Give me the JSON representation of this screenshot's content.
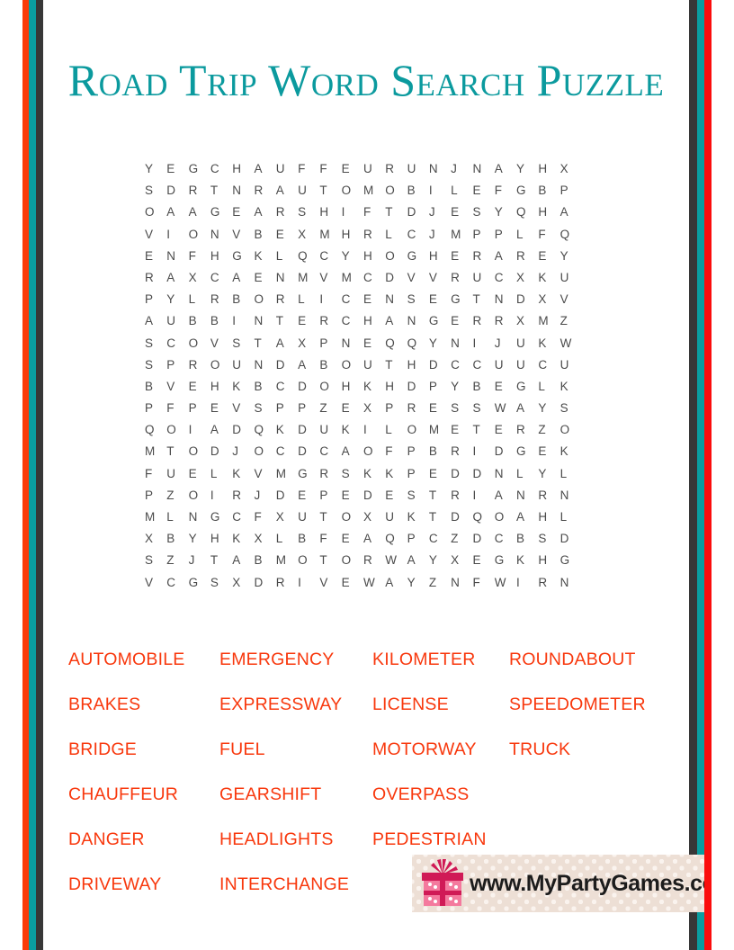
{
  "page": {
    "title": "Road Trip Word Search Puzzle",
    "colors": {
      "title_teal": "#0B9A9E",
      "word_red": "#F8380D",
      "grid_gray": "#4B4B4B",
      "border_red": "#FA3C0A",
      "border_teal": "#0A9DA0",
      "border_dark": "#373737",
      "watermark_bg": "#EDDFD5",
      "gift_pink": "#F47A9E",
      "gift_magenta": "#D01A56"
    }
  },
  "grid": {
    "rows": 20,
    "cols": 20,
    "letters": [
      [
        "Y",
        "E",
        "G",
        "C",
        "H",
        "A",
        "U",
        "F",
        "F",
        "E",
        "U",
        "R",
        "U",
        "N",
        "J",
        "N",
        "A",
        "Y",
        "H",
        "X"
      ],
      [
        "S",
        "D",
        "R",
        "T",
        "N",
        "R",
        "A",
        "U",
        "T",
        "O",
        "M",
        "O",
        "B",
        "I",
        "L",
        "E",
        "F",
        "G",
        "B",
        "P"
      ],
      [
        "O",
        "A",
        "A",
        "G",
        "E",
        "A",
        "R",
        "S",
        "H",
        "I",
        "F",
        "T",
        "D",
        "J",
        "E",
        "S",
        "Y",
        "Q",
        "H",
        "A"
      ],
      [
        "V",
        "I",
        "O",
        "N",
        "V",
        "B",
        "E",
        "X",
        "M",
        "H",
        "R",
        "L",
        "C",
        "J",
        "M",
        "P",
        "P",
        "L",
        "F",
        "Q"
      ],
      [
        "E",
        "N",
        "F",
        "H",
        "G",
        "K",
        "L",
        "Q",
        "C",
        "Y",
        "H",
        "O",
        "G",
        "H",
        "E",
        "R",
        "A",
        "R",
        "E",
        "Y"
      ],
      [
        "R",
        "A",
        "X",
        "C",
        "A",
        "E",
        "N",
        "M",
        "V",
        "M",
        "C",
        "D",
        "V",
        "V",
        "R",
        "U",
        "C",
        "X",
        "K",
        "U"
      ],
      [
        "P",
        "Y",
        "L",
        "R",
        "B",
        "O",
        "R",
        "L",
        "I",
        "C",
        "E",
        "N",
        "S",
        "E",
        "G",
        "T",
        "N",
        "D",
        "X",
        "V"
      ],
      [
        "A",
        "U",
        "B",
        "B",
        "I",
        "N",
        "T",
        "E",
        "R",
        "C",
        "H",
        "A",
        "N",
        "G",
        "E",
        "R",
        "R",
        "X",
        "M",
        "Z"
      ],
      [
        "S",
        "C",
        "O",
        "V",
        "S",
        "T",
        "A",
        "X",
        "P",
        "N",
        "E",
        "Q",
        "Q",
        "Y",
        "N",
        "I",
        "J",
        "U",
        "K",
        "W"
      ],
      [
        "S",
        "P",
        "R",
        "O",
        "U",
        "N",
        "D",
        "A",
        "B",
        "O",
        "U",
        "T",
        "H",
        "D",
        "C",
        "C",
        "U",
        "U",
        "C",
        "U"
      ],
      [
        "B",
        "V",
        "E",
        "H",
        "K",
        "B",
        "C",
        "D",
        "O",
        "H",
        "K",
        "H",
        "D",
        "P",
        "Y",
        "B",
        "E",
        "G",
        "L",
        "K"
      ],
      [
        "P",
        "F",
        "P",
        "E",
        "V",
        "S",
        "P",
        "P",
        "Z",
        "E",
        "X",
        "P",
        "R",
        "E",
        "S",
        "S",
        "W",
        "A",
        "Y",
        "S"
      ],
      [
        "Q",
        "O",
        "I",
        "A",
        "D",
        "Q",
        "K",
        "D",
        "U",
        "K",
        "I",
        "L",
        "O",
        "M",
        "E",
        "T",
        "E",
        "R",
        "Z",
        "O"
      ],
      [
        "M",
        "T",
        "O",
        "D",
        "J",
        "O",
        "C",
        "D",
        "C",
        "A",
        "O",
        "F",
        "P",
        "B",
        "R",
        "I",
        "D",
        "G",
        "E",
        "K"
      ],
      [
        "F",
        "U",
        "E",
        "L",
        "K",
        "V",
        "M",
        "G",
        "R",
        "S",
        "K",
        "K",
        "P",
        "E",
        "D",
        "D",
        "N",
        "L",
        "Y",
        "L"
      ],
      [
        "P",
        "Z",
        "O",
        "I",
        "R",
        "J",
        "D",
        "E",
        "P",
        "E",
        "D",
        "E",
        "S",
        "T",
        "R",
        "I",
        "A",
        "N",
        "R",
        "N"
      ],
      [
        "M",
        "L",
        "N",
        "G",
        "C",
        "F",
        "X",
        "U",
        "T",
        "O",
        "X",
        "U",
        "K",
        "T",
        "D",
        "Q",
        "O",
        "A",
        "H",
        "L"
      ],
      [
        "X",
        "B",
        "Y",
        "H",
        "K",
        "X",
        "L",
        "B",
        "F",
        "E",
        "A",
        "Q",
        "P",
        "C",
        "Z",
        "D",
        "C",
        "B",
        "S",
        "D"
      ],
      [
        "S",
        "Z",
        "J",
        "T",
        "A",
        "B",
        "M",
        "O",
        "T",
        "O",
        "R",
        "W",
        "A",
        "Y",
        "X",
        "E",
        "G",
        "K",
        "H",
        "G"
      ],
      [
        "V",
        "C",
        "G",
        "S",
        "X",
        "D",
        "R",
        "I",
        "V",
        "E",
        "W",
        "A",
        "Y",
        "Z",
        "N",
        "F",
        "W",
        "I",
        "R",
        "N"
      ]
    ]
  },
  "word_list": {
    "columns": [
      [
        "AUTOMOBILE",
        "BRAKES",
        "BRIDGE",
        "CHAUFFEUR",
        "DANGER",
        "DRIVEWAY"
      ],
      [
        "EMERGENCY",
        "EXPRESSWAY",
        "FUEL",
        "GEARSHIFT",
        "HEADLIGHTS",
        "INTERCHANGE"
      ],
      [
        "KILOMETER",
        "LICENSE",
        "MOTORWAY",
        "OVERPASS",
        "PEDESTRIAN",
        ""
      ],
      [
        "ROUNDABOUT",
        "SPEEDOMETER",
        "TRUCK",
        "",
        "",
        ""
      ]
    ]
  },
  "watermark": {
    "text": "www.MyPartyGames.com",
    "icon": "gift-box-icon"
  }
}
